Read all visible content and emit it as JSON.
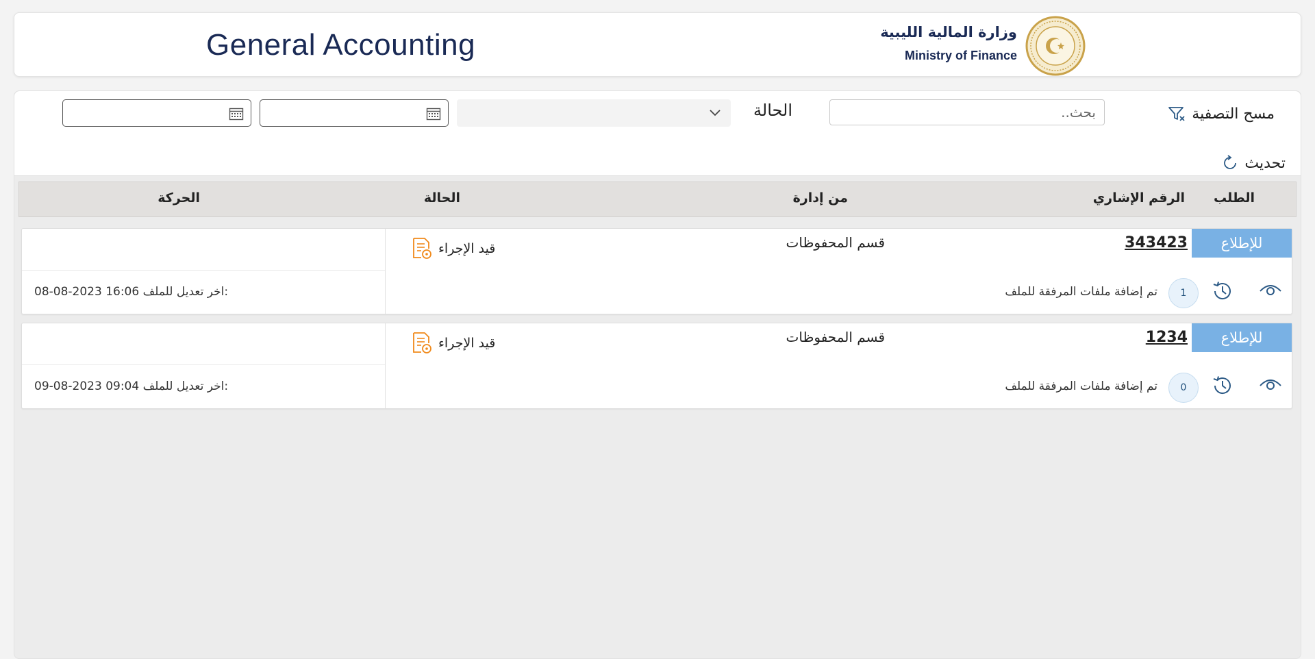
{
  "header": {
    "title": "General Accounting",
    "brand_ar": "وزارة المالية الليبية",
    "brand_en": "Ministry of Finance"
  },
  "filters": {
    "clear_label": "مسح التصفية",
    "search_placeholder": "بحث..",
    "status_label": "الحالة",
    "status_value": "",
    "refresh_label": "تحديث"
  },
  "table": {
    "headers": {
      "request": "الطلب",
      "ref_number": "الرقم الإشاري",
      "from_dept": "من إدارة",
      "status": "الحالة",
      "movement": "الحركة"
    },
    "rows": [
      {
        "type": "للإطلاع",
        "ref_number": "343423",
        "from_dept": "قسم المحفوظات",
        "status": "قيد الإجراء",
        "attachments_count": "1",
        "files_note": "تم إضافة ملفات المرفقة للملف",
        "modified_label": "اخر تعديل للملف:",
        "modified_date": "08-08-2023 16:06"
      },
      {
        "type": "للإطلاع",
        "ref_number": "1234",
        "from_dept": "قسم المحفوظات",
        "status": "قيد الإجراء",
        "attachments_count": "0",
        "files_note": "تم إضافة ملفات المرفقة للملف",
        "modified_label": "اخر تعديل للملف:",
        "modified_date": "09-08-2023 09:04"
      }
    ]
  },
  "colors": {
    "title": "#1a2a55",
    "badge": "#79b1e4",
    "status_icon": "#f0891a",
    "action_icon": "#2c5a86",
    "seal_gold": "#c9a24a"
  },
  "icons": {
    "seal": "ministry-seal-icon",
    "clear_filter": "filter-clear-icon",
    "refresh": "refresh-icon",
    "status": "document-pending-icon",
    "view": "eye-icon",
    "history": "history-icon",
    "calendar": "calendar-icon",
    "dropdown": "chevron-down-icon"
  }
}
